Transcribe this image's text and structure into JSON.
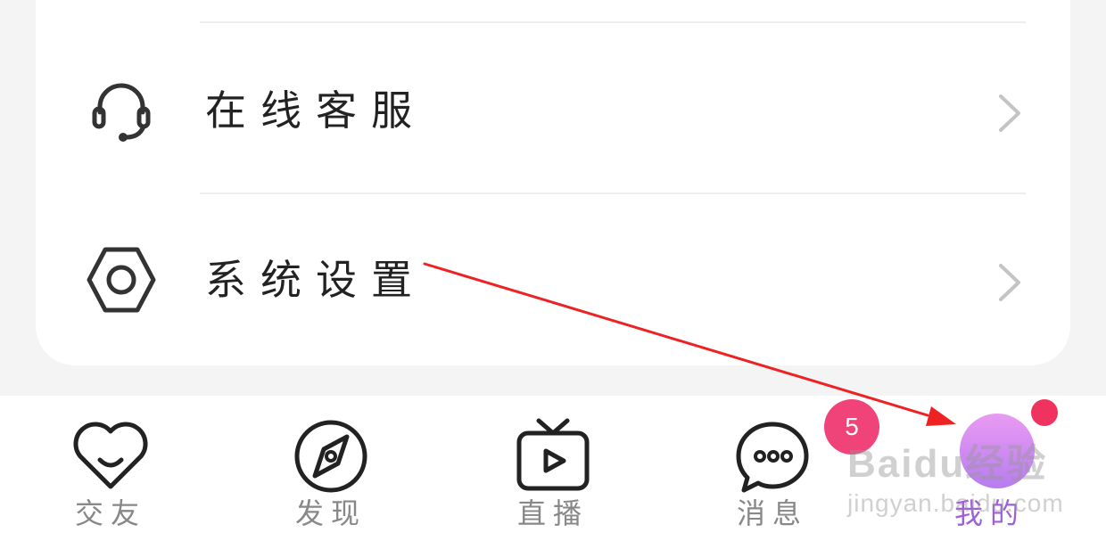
{
  "settings_menu": {
    "items": [
      {
        "label": "在线客服",
        "icon": "headset-icon"
      },
      {
        "label": "系统设置",
        "icon": "settings-hexagon-icon"
      }
    ]
  },
  "tabbar": {
    "tabs": [
      {
        "label": "交友",
        "icon": "heart-smile-icon"
      },
      {
        "label": "发现",
        "icon": "compass-icon"
      },
      {
        "label": "直播",
        "icon": "tv-play-icon"
      },
      {
        "label": "消息",
        "icon": "chat-bubble-icon",
        "badge": "5"
      },
      {
        "label": "我的",
        "icon": "avatar",
        "active": true
      }
    ]
  },
  "watermark": {
    "line1": "Baidu经验",
    "line2": "jingyan.baidu.com"
  },
  "colors": {
    "badge": "#f0437a",
    "active_tab": "#9e5fd8",
    "annotation_arrow": "#ee2222"
  }
}
